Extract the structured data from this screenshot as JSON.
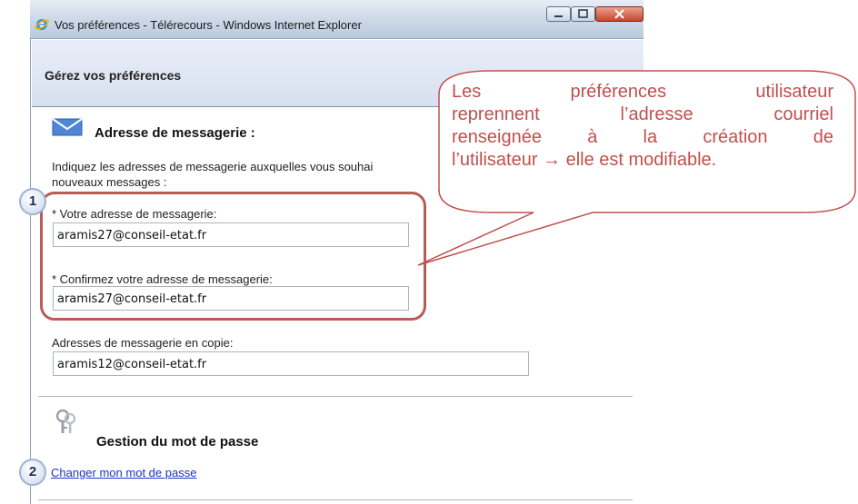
{
  "window": {
    "title": "Vos préférences - Télérecours - Windows Internet Explorer"
  },
  "page": {
    "title": "Gérez vos préférences"
  },
  "email_section": {
    "title": "Adresse de messagerie :",
    "description_line1": "Indiquez les adresses de messagerie auxquelles vous souhai",
    "description_line2": "nouveaux messages :",
    "email_label": "* Votre adresse de messagerie:",
    "email_value": "aramis27@conseil-etat.fr",
    "confirm_label": "* Confirmez votre adresse de messagerie:",
    "confirm_value": "aramis27@conseil-etat.fr",
    "cc_label": "Adresses de messagerie en copie:",
    "cc_value": "aramis12@conseil-etat.fr"
  },
  "password_section": {
    "title": "Gestion du mot de passe",
    "change_link": "Changer mon mot de passe"
  },
  "annotations": {
    "badge1": "1",
    "badge2": "2",
    "callout_line1": "Les préférences utilisateur",
    "callout_line2": "reprennent l’adresse courriel",
    "callout_line3": "renseignée à la création de",
    "callout_line4": "l’utilisateur → elle est modifiable."
  },
  "colors": {
    "annotation": "#c0504d",
    "header_band": "#dfe6f3",
    "link": "#1a33cc"
  },
  "icons": [
    "ie-icon",
    "minimize-icon",
    "maximize-icon",
    "close-icon",
    "envelope-icon",
    "keys-icon"
  ]
}
